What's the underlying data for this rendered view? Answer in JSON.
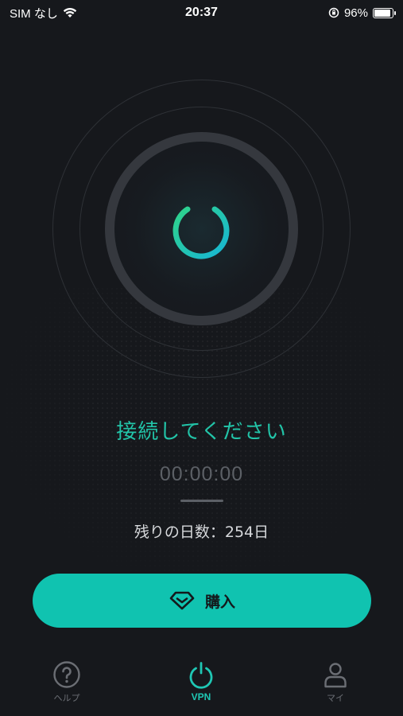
{
  "status_bar": {
    "carrier": "SIM なし",
    "time": "20:37",
    "battery": "96%",
    "battery_level": 0.96
  },
  "main": {
    "connect_prompt": "接続してください",
    "timer": "00:00:00",
    "remaining_days": "残りの日数：254日"
  },
  "buy_button": {
    "label": "購入"
  },
  "tabs": [
    {
      "label": "ヘルプ",
      "icon": "question-icon"
    },
    {
      "label": "VPN",
      "icon": "power-icon"
    },
    {
      "label": "マイ",
      "icon": "person-icon"
    }
  ],
  "colors": {
    "accent": "#22c4a8",
    "button": "#10c3b0",
    "background": "#16181c"
  }
}
